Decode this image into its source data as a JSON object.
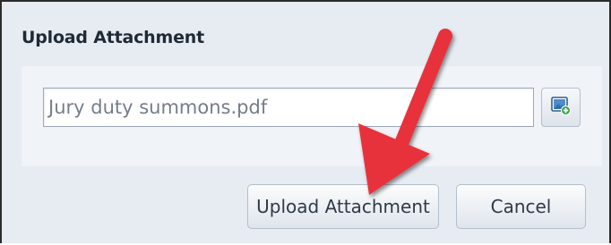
{
  "dialog": {
    "title": "Upload Attachment"
  },
  "upload": {
    "file_value": "Jury duty summons.pdf",
    "browse_icon": "image-add-icon"
  },
  "footer": {
    "upload_label": "Upload Attachment",
    "cancel_label": "Cancel"
  },
  "annotation": {
    "arrow_color": "#e8313b"
  }
}
